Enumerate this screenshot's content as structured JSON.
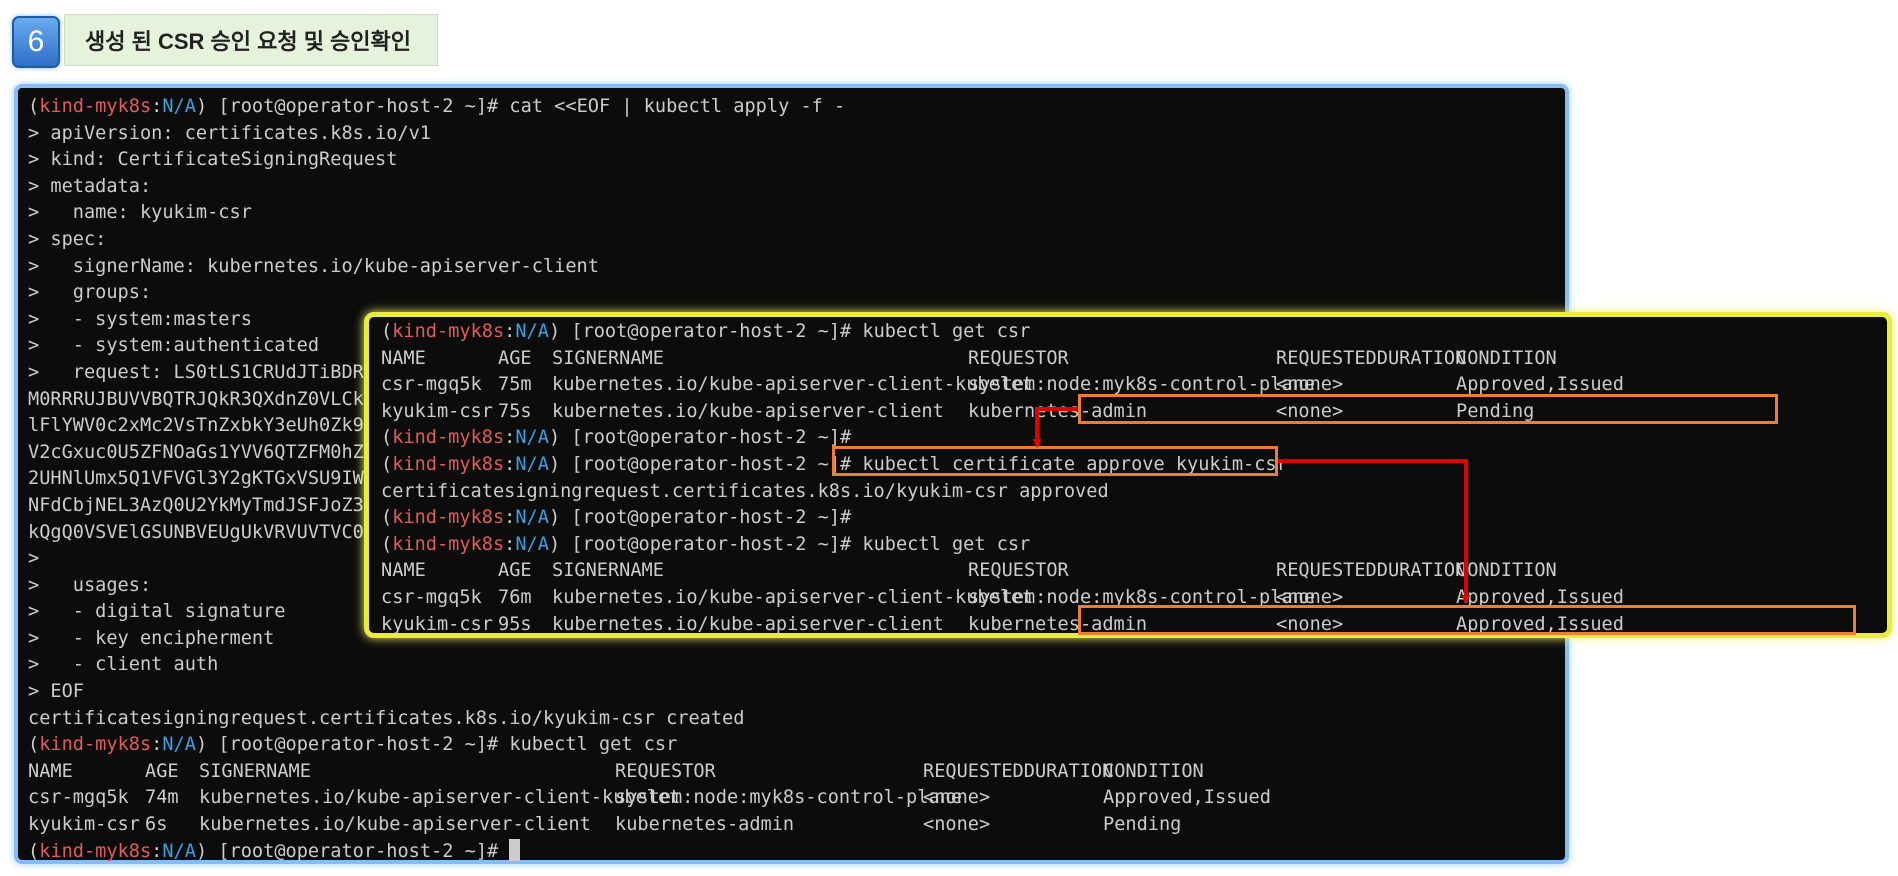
{
  "header": {
    "step_number": "6",
    "title": "생성 된 CSR 승인 요청 및 승인확인"
  },
  "prompt": {
    "open": "(",
    "cluster": "kind-myk8s",
    "sep": ":",
    "ns": "N/A",
    "close": ")",
    "host": " [root@operator-host-2 ~]# "
  },
  "main_terminal": {
    "command_line": "cat <<EOF | kubectl apply -f -",
    "heredoc": [
      "> apiVersion: certificates.k8s.io/v1",
      "> kind: CertificateSigningRequest",
      "> metadata:",
      ">   name: kyukim-csr",
      "> spec:",
      ">   signerName: kubernetes.io/kube-apiserver-client",
      ">   groups:",
      ">   - system:masters",
      ">   - system:authenticated",
      ">   request: LS0tLS1CRUdJTiBDRVJ",
      "M0RRRUJBUVVBQTRJQkR3QXdnZ0VLCkFv",
      "lFlYWV0c2xMc2VsTnZxbkY3eUh0Zk9Tb",
      "V2cGxuc0U5ZFNOaGs1YVV6QTZFM0hZUE",
      "2UHNlUmx5Q1VFVGl3Y2gKTGxVSU9IWlB",
      "NFdCbjNEL3AzQ0U2YkMyTmdJSFJoZ3VC",
      "kQgQ0VSVElGSUNBVEUgUkVRVUVTVC0tL",
      ">",
      ">   usages:",
      ">   - digital signature",
      ">   - key encipherment",
      ">   - client auth",
      "> EOF",
      "certificatesigningrequest.certificates.k8s.io/kyukim-csr created"
    ],
    "get_command": "kubectl get csr",
    "table": {
      "headers": [
        "NAME",
        "AGE",
        "SIGNERNAME",
        "REQUESTOR",
        "REQUESTEDDURATION",
        "CONDITION"
      ],
      "rows": [
        [
          "csr-mgq5k",
          "74m",
          "kubernetes.io/kube-apiserver-client-kubelet",
          "system:node:myk8s-control-plane",
          "<none>",
          "Approved,Issued"
        ],
        [
          "kyukim-csr",
          "6s",
          "kubernetes.io/kube-apiserver-client",
          "kubernetes-admin",
          "<none>",
          "Pending"
        ]
      ]
    }
  },
  "overlay_terminal": {
    "get_command": "kubectl get csr",
    "headers": [
      "NAME",
      "AGE",
      "SIGNERNAME",
      "REQUESTOR",
      "REQUESTEDDURATION",
      "CONDITION"
    ],
    "table1": [
      [
        "csr-mgq5k",
        "75m",
        "kubernetes.io/kube-apiserver-client-kubelet",
        "system:node:myk8s-control-plane",
        "<none>",
        "Approved,Issued"
      ],
      [
        "kyukim-csr",
        "75s",
        "kubernetes.io/kube-apiserver-client",
        "kubernetes-admin",
        "<none>",
        "Pending"
      ]
    ],
    "approve_command": "kubectl certificate approve kyukim-csr",
    "approve_output": "certificatesigningrequest.certificates.k8s.io/kyukim-csr approved",
    "table2": [
      [
        "csr-mgq5k",
        "76m",
        "kubernetes.io/kube-apiserver-client-kubelet",
        "system:node:myk8s-control-plane",
        "<none>",
        "Approved,Issued"
      ],
      [
        "kyukim-csr",
        "95s",
        "kubernetes.io/kube-apiserver-client",
        "kubernetes-admin",
        "<none>",
        "Approved,Issued"
      ]
    ]
  },
  "colors": {
    "highlight": "#ed7d31",
    "arrow": "#e00000",
    "overlay_border": "#eaeb3a",
    "main_border": "#86bdf5"
  }
}
